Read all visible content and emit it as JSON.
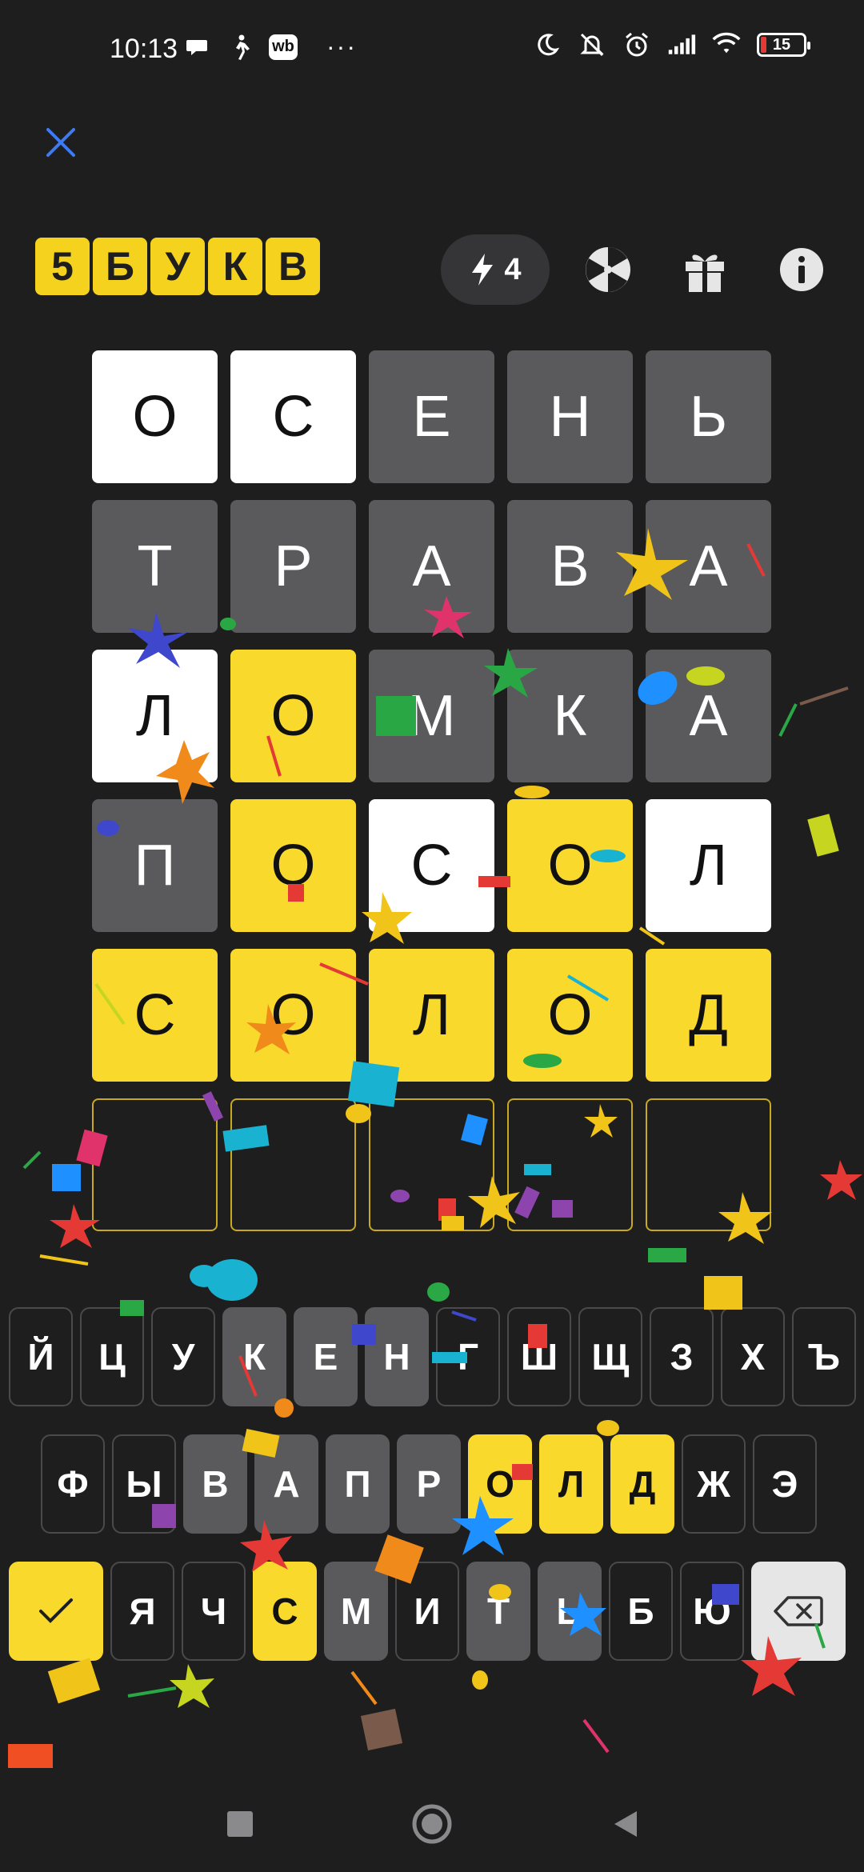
{
  "status_bar": {
    "time": "10:13",
    "wb_label": "wb",
    "more": "···",
    "battery": "15"
  },
  "header": {
    "logo_letters": [
      "5",
      "Б",
      "У",
      "К",
      "В"
    ],
    "hints_count": "4"
  },
  "board": {
    "rows": [
      [
        {
          "l": "О",
          "s": "white"
        },
        {
          "l": "С",
          "s": "white"
        },
        {
          "l": "Е",
          "s": "gray"
        },
        {
          "l": "Н",
          "s": "gray"
        },
        {
          "l": "Ь",
          "s": "gray"
        }
      ],
      [
        {
          "l": "Т",
          "s": "gray"
        },
        {
          "l": "Р",
          "s": "gray"
        },
        {
          "l": "А",
          "s": "gray"
        },
        {
          "l": "В",
          "s": "gray"
        },
        {
          "l": "А",
          "s": "gray"
        }
      ],
      [
        {
          "l": "Л",
          "s": "white"
        },
        {
          "l": "О",
          "s": "yellow"
        },
        {
          "l": "М",
          "s": "gray"
        },
        {
          "l": "К",
          "s": "gray"
        },
        {
          "l": "А",
          "s": "gray"
        }
      ],
      [
        {
          "l": "П",
          "s": "gray"
        },
        {
          "l": "О",
          "s": "yellow"
        },
        {
          "l": "С",
          "s": "white"
        },
        {
          "l": "О",
          "s": "yellow"
        },
        {
          "l": "Л",
          "s": "white"
        }
      ],
      [
        {
          "l": "С",
          "s": "yellow"
        },
        {
          "l": "О",
          "s": "yellow"
        },
        {
          "l": "Л",
          "s": "yellow"
        },
        {
          "l": "О",
          "s": "yellow"
        },
        {
          "l": "Д",
          "s": "yellow"
        }
      ],
      [
        {
          "l": "",
          "s": "empty"
        },
        {
          "l": "",
          "s": "empty"
        },
        {
          "l": "",
          "s": "empty"
        },
        {
          "l": "",
          "s": "empty"
        },
        {
          "l": "",
          "s": "empty"
        }
      ]
    ]
  },
  "keyboard": {
    "row1": [
      {
        "l": "Й",
        "s": "none"
      },
      {
        "l": "Ц",
        "s": "none"
      },
      {
        "l": "У",
        "s": "none"
      },
      {
        "l": "К",
        "s": "gray"
      },
      {
        "l": "Е",
        "s": "gray"
      },
      {
        "l": "Н",
        "s": "gray"
      },
      {
        "l": "Г",
        "s": "none"
      },
      {
        "l": "Ш",
        "s": "none"
      },
      {
        "l": "Щ",
        "s": "none"
      },
      {
        "l": "З",
        "s": "none"
      },
      {
        "l": "Х",
        "s": "none"
      },
      {
        "l": "Ъ",
        "s": "none"
      }
    ],
    "row2": [
      {
        "l": "Ф",
        "s": "none"
      },
      {
        "l": "Ы",
        "s": "none"
      },
      {
        "l": "В",
        "s": "gray"
      },
      {
        "l": "А",
        "s": "gray"
      },
      {
        "l": "П",
        "s": "gray"
      },
      {
        "l": "Р",
        "s": "gray"
      },
      {
        "l": "О",
        "s": "yellow"
      },
      {
        "l": "Л",
        "s": "yellow"
      },
      {
        "l": "Д",
        "s": "yellow"
      },
      {
        "l": "Ж",
        "s": "none"
      },
      {
        "l": "Э",
        "s": "none"
      }
    ],
    "row3": [
      {
        "l": "Я",
        "s": "none"
      },
      {
        "l": "Ч",
        "s": "none"
      },
      {
        "l": "С",
        "s": "yellow"
      },
      {
        "l": "М",
        "s": "gray"
      },
      {
        "l": "И",
        "s": "none"
      },
      {
        "l": "Т",
        "s": "gray"
      },
      {
        "l": "Ь",
        "s": "gray"
      },
      {
        "l": "Б",
        "s": "none"
      },
      {
        "l": "Ю",
        "s": "none"
      }
    ]
  },
  "colors": {
    "background": "#1e1e1f",
    "yellow": "#f9d92c",
    "gray": "#5a5a5c",
    "white": "#ffffff",
    "accent_blue": "#3d7bf5"
  },
  "icons": [
    "close-icon",
    "lightning-icon",
    "wheel-icon",
    "gift-icon",
    "info-icon",
    "check-icon",
    "backspace-icon"
  ]
}
